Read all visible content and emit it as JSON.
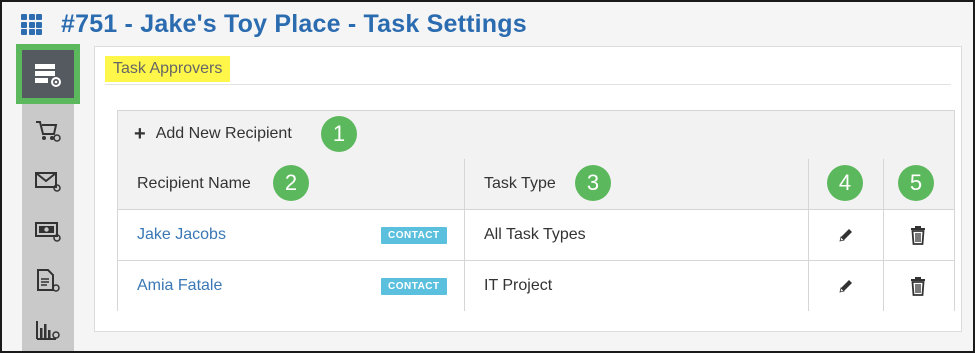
{
  "header": {
    "title": "#751 - Jake's Toy Place - Task Settings",
    "app_menu_icon": "grid-icon"
  },
  "sidebar": {
    "items": [
      {
        "icon": "task-settings-icon",
        "active": true
      },
      {
        "icon": "cart-settings-icon",
        "active": false
      },
      {
        "icon": "email-settings-icon",
        "active": false
      },
      {
        "icon": "billing-settings-icon",
        "active": false
      },
      {
        "icon": "document-settings-icon",
        "active": false
      },
      {
        "icon": "reports-settings-icon",
        "active": false
      }
    ]
  },
  "section": {
    "title": "Task Approvers"
  },
  "table": {
    "add_label": "Add New Recipient",
    "add_icon": "plus-icon",
    "columns": {
      "name": "Recipient Name",
      "type": "Task Type"
    },
    "rows": [
      {
        "name": "Jake Jacobs",
        "badge": "CONTACT",
        "type": "All Task Types"
      },
      {
        "name": "Amia Fatale",
        "badge": "CONTACT",
        "type": "IT Project"
      }
    ],
    "edit_icon": "pencil-icon",
    "delete_icon": "trash-icon"
  },
  "callouts": [
    "1",
    "2",
    "3",
    "4",
    "5"
  ],
  "colors": {
    "title_blue": "#2b6cb0",
    "link_blue": "#3a78b5",
    "callout_green": "#5cb85c",
    "highlight_yellow": "#fff64a",
    "badge_blue": "#5bc0de"
  }
}
